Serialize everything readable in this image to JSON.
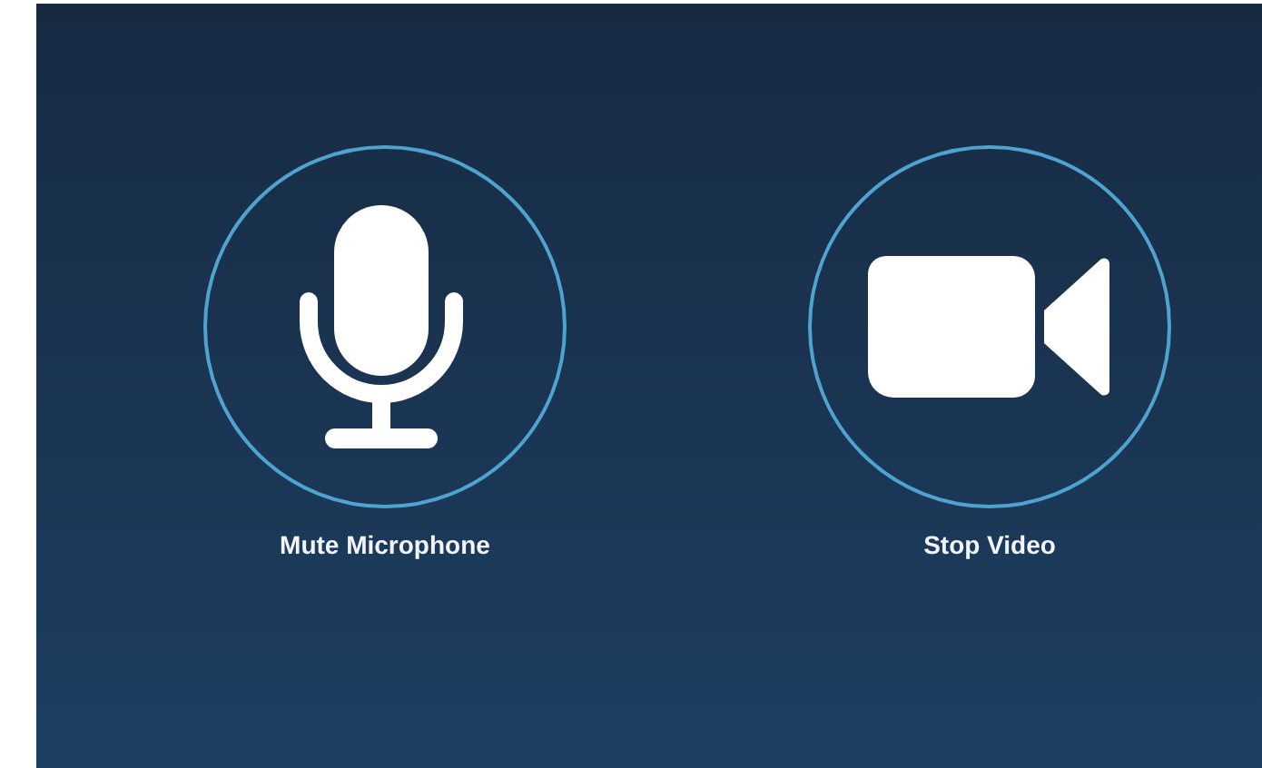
{
  "controls": [
    {
      "kind": "microphone",
      "label": "Mute Microphone"
    },
    {
      "kind": "video",
      "label": "Stop Video"
    }
  ]
}
